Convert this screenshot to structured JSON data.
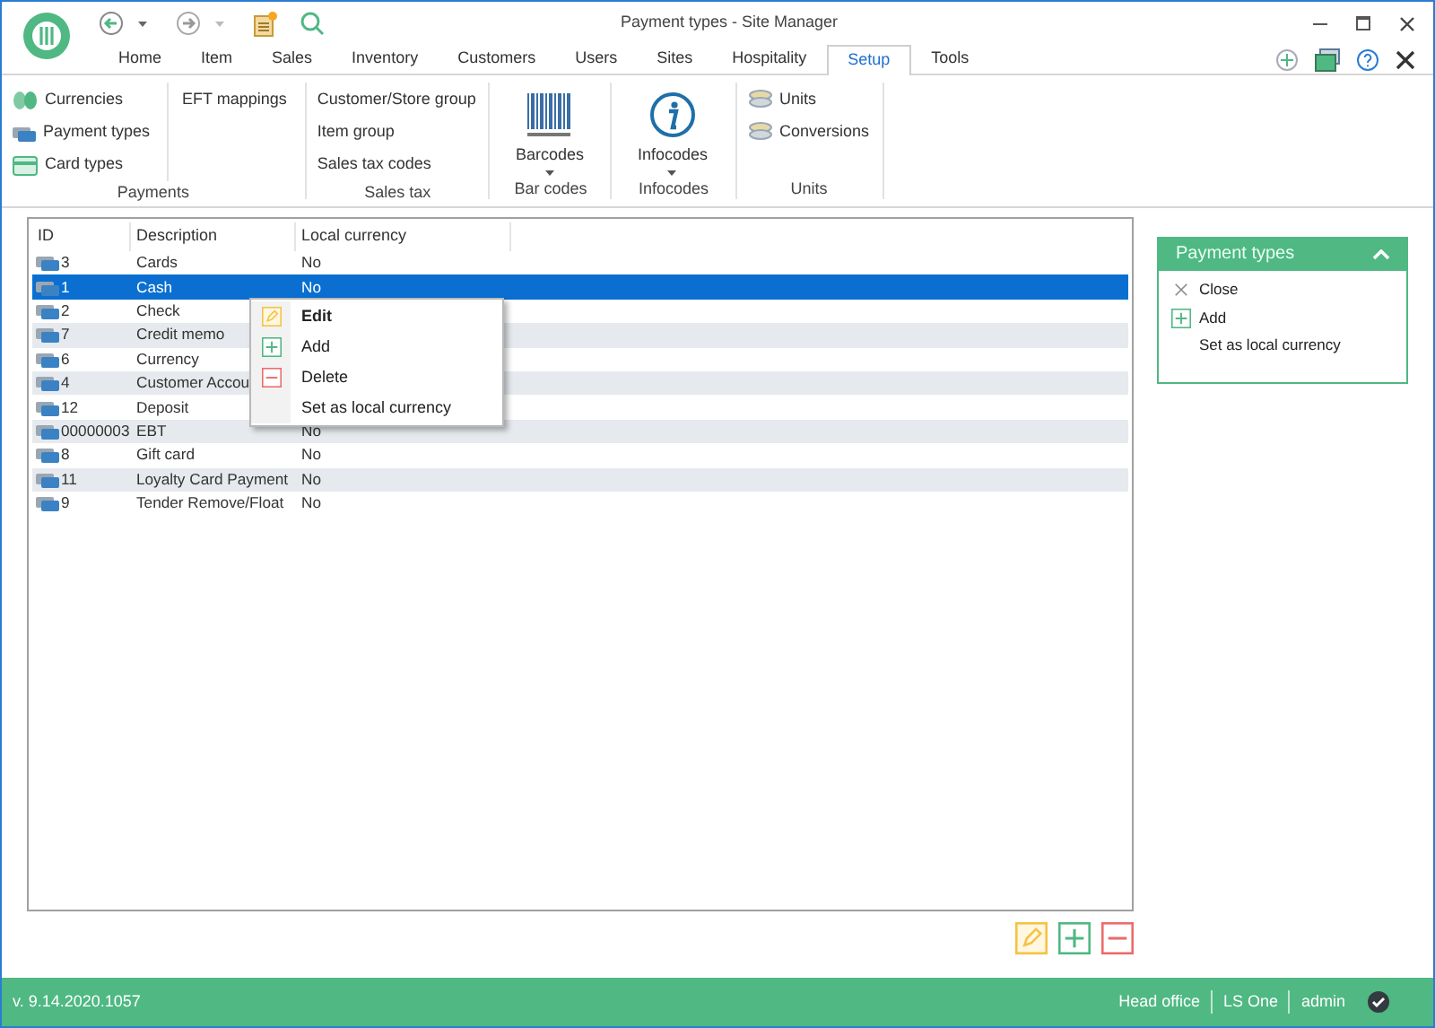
{
  "window": {
    "title": "Payment types - Site Manager"
  },
  "tabs": [
    {
      "label": "Home",
      "selected": false
    },
    {
      "label": "Item",
      "selected": false
    },
    {
      "label": "Sales",
      "selected": false
    },
    {
      "label": "Inventory",
      "selected": false
    },
    {
      "label": "Customers",
      "selected": false
    },
    {
      "label": "Users",
      "selected": false
    },
    {
      "label": "Sites",
      "selected": false
    },
    {
      "label": "Hospitality",
      "selected": false
    },
    {
      "label": "Setup",
      "selected": true
    },
    {
      "label": "Tools",
      "selected": false
    }
  ],
  "ribbon": [
    {
      "label": "Payments",
      "columns": [
        [
          {
            "kind": "currency",
            "label": "Currencies"
          },
          {
            "kind": "payment",
            "label": "Payment types"
          },
          {
            "kind": "card",
            "label": "Card types"
          }
        ],
        [
          {
            "kind": "plain",
            "label": "EFT mappings"
          }
        ]
      ]
    },
    {
      "label": "Sales tax",
      "columns": [
        [
          {
            "kind": "plain",
            "label": "Customer/Store group"
          },
          {
            "kind": "plain",
            "label": "Item group"
          },
          {
            "kind": "plain",
            "label": "Sales tax codes"
          }
        ]
      ]
    },
    {
      "label": "Bar codes",
      "columns": [
        [
          {
            "kind": "barcode",
            "label": "Barcodes"
          }
        ]
      ]
    },
    {
      "label": "Infocodes",
      "columns": [
        [
          {
            "kind": "info",
            "label": "Infocodes"
          }
        ]
      ]
    },
    {
      "label": "Units",
      "columns": [
        [
          {
            "kind": "units",
            "label": "Units"
          },
          {
            "kind": "units",
            "label": "Conversions"
          }
        ]
      ]
    }
  ],
  "table": {
    "columns": [
      "ID",
      "Description",
      "Local currency"
    ],
    "rows": [
      {
        "id": "3",
        "description": "Cards",
        "local_currency": "No",
        "selected": false
      },
      {
        "id": "1",
        "description": "Cash",
        "local_currency": "No",
        "selected": true
      },
      {
        "id": "2",
        "description": "Check",
        "local_currency": "",
        "selected": false
      },
      {
        "id": "7",
        "description": "Credit memo",
        "local_currency": "",
        "selected": false
      },
      {
        "id": "6",
        "description": "Currency",
        "local_currency": "",
        "selected": false
      },
      {
        "id": "4",
        "description": "Customer Accou",
        "local_currency": "",
        "selected": false
      },
      {
        "id": "12",
        "description": "Deposit",
        "local_currency": "",
        "selected": false
      },
      {
        "id": "00000003",
        "description": "EBT",
        "local_currency": "No",
        "selected": false
      },
      {
        "id": "8",
        "description": "Gift card",
        "local_currency": "No",
        "selected": false
      },
      {
        "id": "11",
        "description": "Loyalty Card Payment",
        "local_currency": "No",
        "selected": false
      },
      {
        "id": "9",
        "description": "Tender Remove/Float",
        "local_currency": "No",
        "selected": false
      }
    ]
  },
  "context_menu": [
    {
      "kind": "edit",
      "label": "Edit",
      "default": true
    },
    {
      "kind": "add",
      "label": "Add",
      "default": false
    },
    {
      "kind": "delete",
      "label": "Delete",
      "default": false
    },
    {
      "kind": "none",
      "label": "Set as local currency",
      "default": false
    }
  ],
  "side_panel": {
    "title": "Payment types",
    "items": [
      {
        "kind": "close",
        "label": "Close"
      },
      {
        "kind": "add",
        "label": "Add"
      },
      {
        "kind": "none",
        "label": "Set as local currency"
      }
    ]
  },
  "status_bar": {
    "version": "v. 9.14.2020.1057",
    "items": [
      "Head office",
      "LS One",
      "admin"
    ]
  }
}
